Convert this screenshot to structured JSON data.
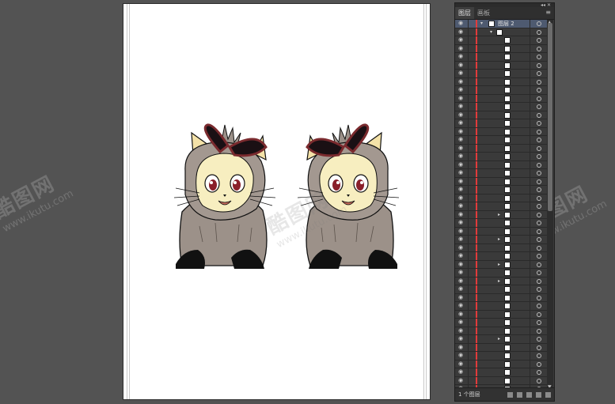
{
  "panel": {
    "tabs": [
      "图层",
      "画板"
    ],
    "active_tab": 0,
    "top_layer_name": "图层 2",
    "footer_count": "1 个图层"
  },
  "watermark": {
    "text": "酷图网",
    "url": "www.ikutu.com"
  },
  "colors": {
    "app_bg": "#535353",
    "panel_bg": "#3a3a3a",
    "selection": "#4e5a70",
    "layer_color": "#e23b3b"
  },
  "layer_rows": 45,
  "expandable_rows": [
    23,
    26,
    29,
    31,
    38
  ],
  "icons": [
    "eye-icon",
    "disclosure-triangle-icon",
    "target-circle-icon",
    "panel-menu-icon",
    "new-layer-icon",
    "delete-layer-icon"
  ]
}
